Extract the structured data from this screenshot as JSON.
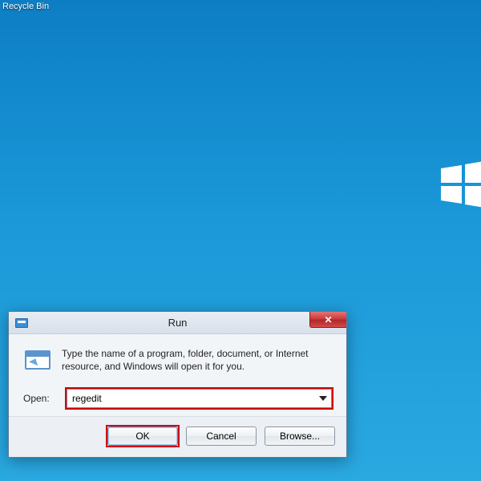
{
  "desktop": {
    "recycle_bin_label": "Recycle Bin"
  },
  "dialog": {
    "title": "Run",
    "description": "Type the name of a program, folder, document, or Internet resource, and Windows will open it for you.",
    "open_label": "Open:",
    "input_value": "regedit",
    "buttons": {
      "ok": "OK",
      "cancel": "Cancel",
      "browse": "Browse..."
    },
    "close_glyph": "✕"
  }
}
